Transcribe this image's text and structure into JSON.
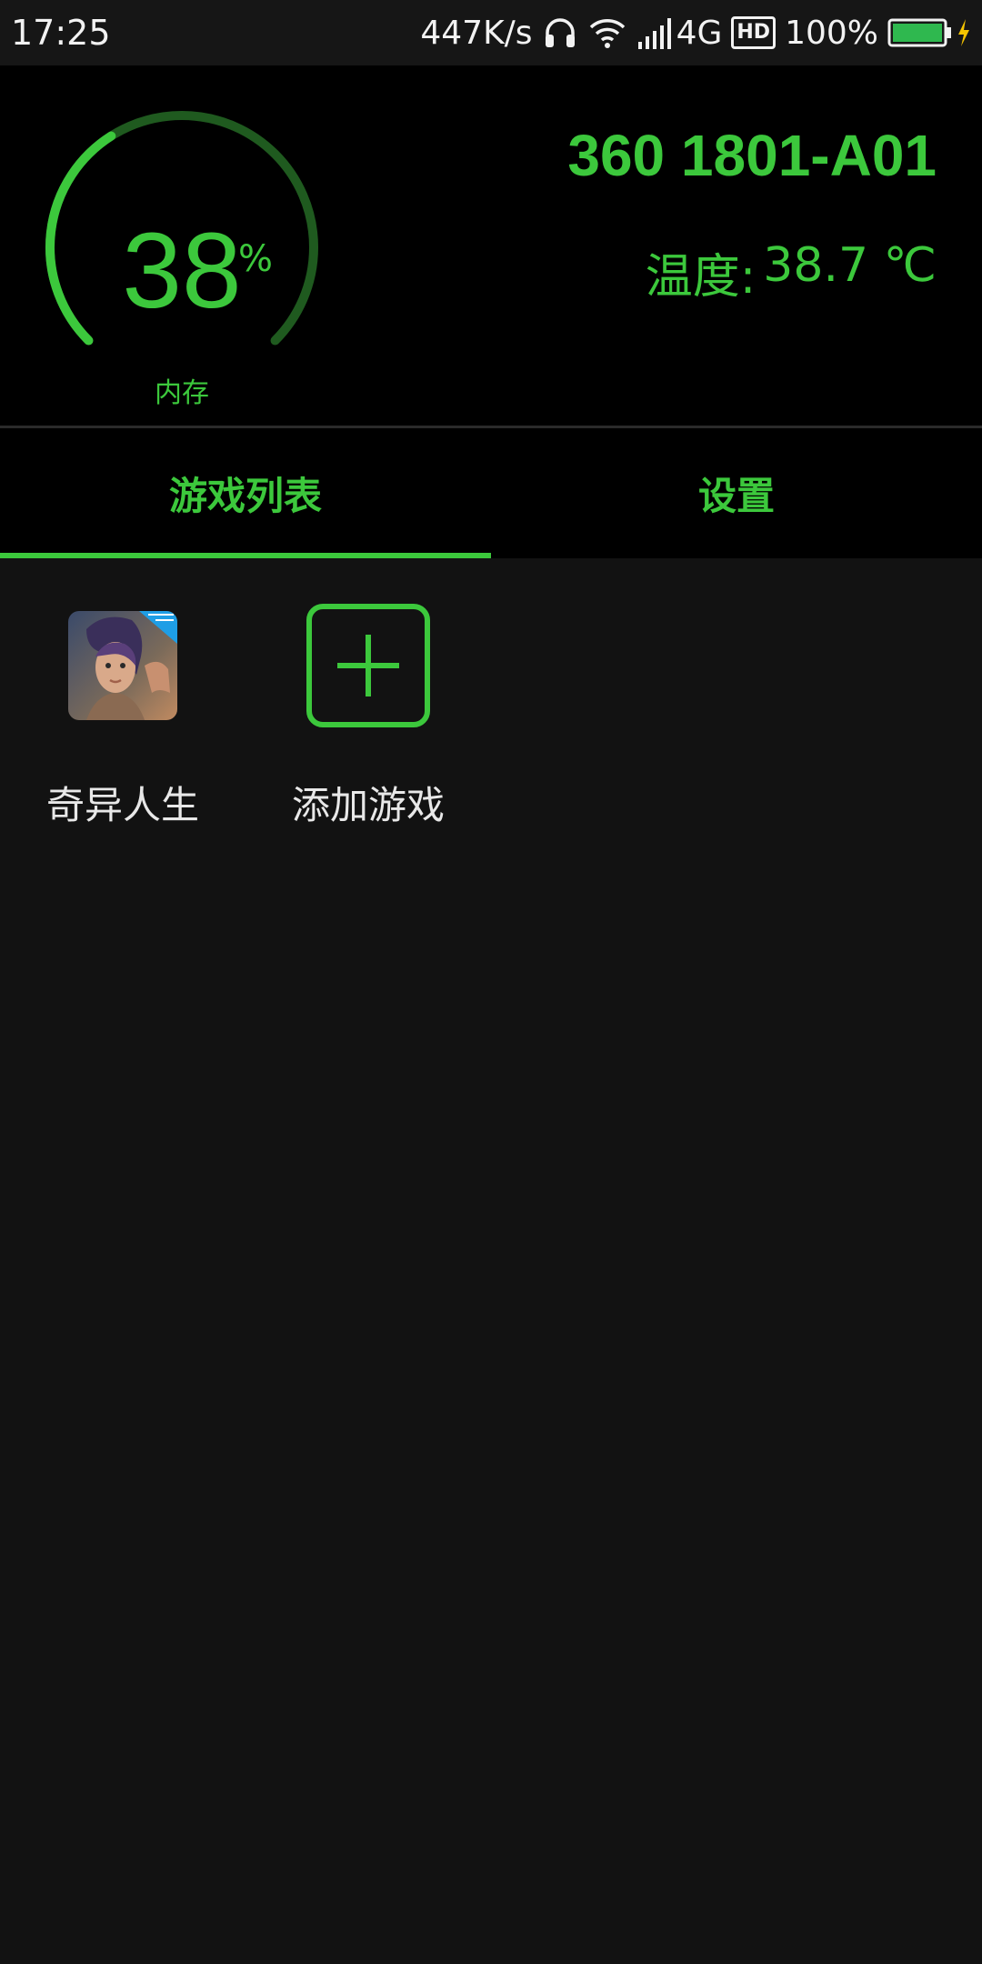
{
  "status_bar": {
    "time": "17:25",
    "net_speed": "447K/s",
    "network_type": "4G",
    "hd_badge": "HD",
    "battery": "100%",
    "icons": [
      "headphones-icon",
      "wifi-icon",
      "signal-icon",
      "hd-icon",
      "battery-icon",
      "charging-icon"
    ]
  },
  "monitor": {
    "memory_percent": "38",
    "memory_unit": "%",
    "memory_label": "内存",
    "memory_fraction": 0.38,
    "device_name": "360 1801-A01",
    "temperature_label": "温度:",
    "temperature_value": "38.7 ℃"
  },
  "tabs": [
    {
      "label": "游戏列表",
      "active": true
    },
    {
      "label": "设置",
      "active": false
    }
  ],
  "games": [
    {
      "name": "奇异人生",
      "icon": "game-cover-icon"
    },
    {
      "name": "添加游戏",
      "icon": "add-icon"
    }
  ],
  "colors": {
    "accent": "#3cc83c",
    "accent_dim": "#1f5a1f",
    "background": "#121212",
    "header_background": "#000000"
  }
}
